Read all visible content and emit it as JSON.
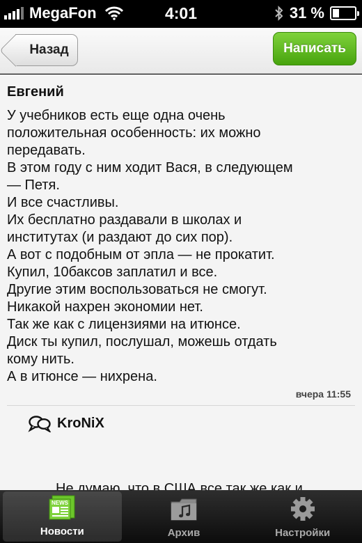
{
  "status": {
    "carrier": "MegaFon",
    "time": "4:01",
    "battery_text": "31 %",
    "battery_level": 0.31
  },
  "nav": {
    "back_label": "Назад",
    "write_label": "Написать",
    "accent": "#5cb91d"
  },
  "message": {
    "author": "Евгений",
    "lines": [
      "У учебников есть еще одна очень",
      "положительная особенность: их можно",
      "передавать.",
      "В этом году с ним ходит Вася, в следующем",
      "— Петя.",
      "И все счастливы.",
      "Их бесплатно раздавали в школах и",
      "институтах (и раздают до сих пор).",
      "А вот с подобным от эпла — не прокатит.",
      "Купил, 10баксов заплатил и все.",
      "Другие этим воспользоваться не смогут.",
      "Никакой нахрен экономии нет.",
      "Так же как с лицензиями на итюнсе.",
      "Диск ты купил, послушал, можешь отдать",
      "кому нить.",
      "А в итюнсе — нихрена."
    ],
    "timestamp": "вчера 11:55"
  },
  "reply": {
    "icon": "speech-bubbles-icon",
    "author": "KroNiX",
    "preview": "Не думаю, что в США все так же как и"
  },
  "tabs": [
    {
      "label": "Новости",
      "icon": "news-icon",
      "active": true
    },
    {
      "label": "Архив",
      "icon": "archive-folder-icon",
      "active": false
    },
    {
      "label": "Настройки",
      "icon": "gear-icon",
      "active": false
    }
  ]
}
